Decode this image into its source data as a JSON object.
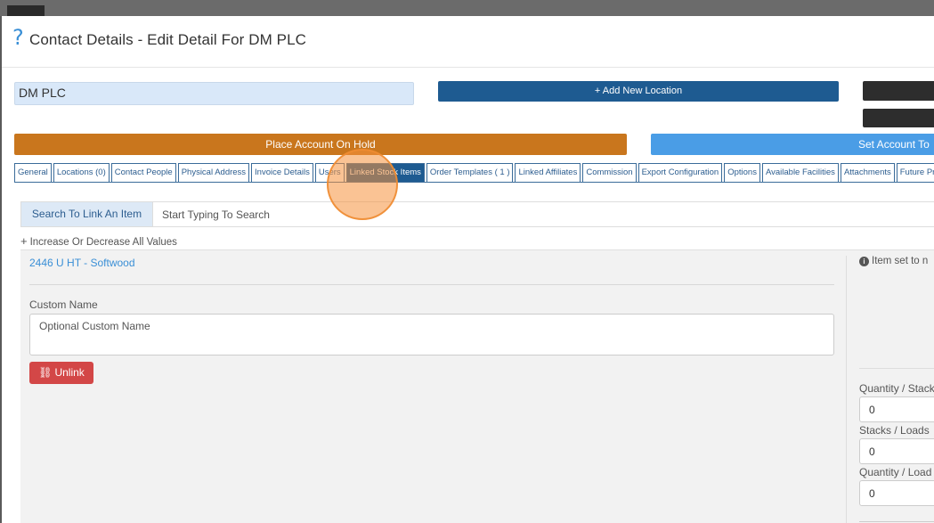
{
  "header": {
    "title": "Contact Details - Edit Detail For DM PLC",
    "help_icon": "?"
  },
  "contact": {
    "name_value": "DM PLC"
  },
  "buttons": {
    "add_location": "+ Add New Location",
    "place_on_hold": "Place Account On Hold",
    "set_account": "Set Account To"
  },
  "tabs": [
    {
      "label": "General"
    },
    {
      "label": "Locations (0)"
    },
    {
      "label": "Contact People"
    },
    {
      "label": "Physical Address"
    },
    {
      "label": "Invoice Details"
    },
    {
      "label": "Users"
    },
    {
      "label": "Linked Stock Items",
      "active": true
    },
    {
      "label": "Order Templates ( 1 )"
    },
    {
      "label": "Linked Affiliates"
    },
    {
      "label": "Commission"
    },
    {
      "label": "Export Configuration"
    },
    {
      "label": "Options"
    },
    {
      "label": "Available Facilities"
    },
    {
      "label": "Attachments"
    },
    {
      "label": "Future Pric"
    }
  ],
  "search": {
    "label": "Search To Link An Item",
    "placeholder": "Start Typing To Search"
  },
  "increase_decrease": "Increase Or Decrease All Values",
  "item": {
    "link_text": "2446 U HT - Softwood",
    "custom_name_label": "Custom Name",
    "custom_name_placeholder": "Optional Custom Name",
    "unlink_label": "Unlink",
    "info_note": "Item set to n",
    "fields": [
      {
        "label": "Quantity / Stack",
        "value": "0"
      },
      {
        "label": "Stacks / Loads",
        "value": "0"
      },
      {
        "label": "Quantity / Load",
        "value": "0"
      }
    ]
  },
  "colors": {
    "primary": "#1e5b91",
    "hold": "#c9761d",
    "set_account": "#4a9de6",
    "danger": "#d34747",
    "link": "#3a8fd6"
  },
  "icons": {
    "help": "question-mark-icon",
    "plus": "plus-icon",
    "unlink": "unlink-icon",
    "info": "info-circle-icon"
  }
}
